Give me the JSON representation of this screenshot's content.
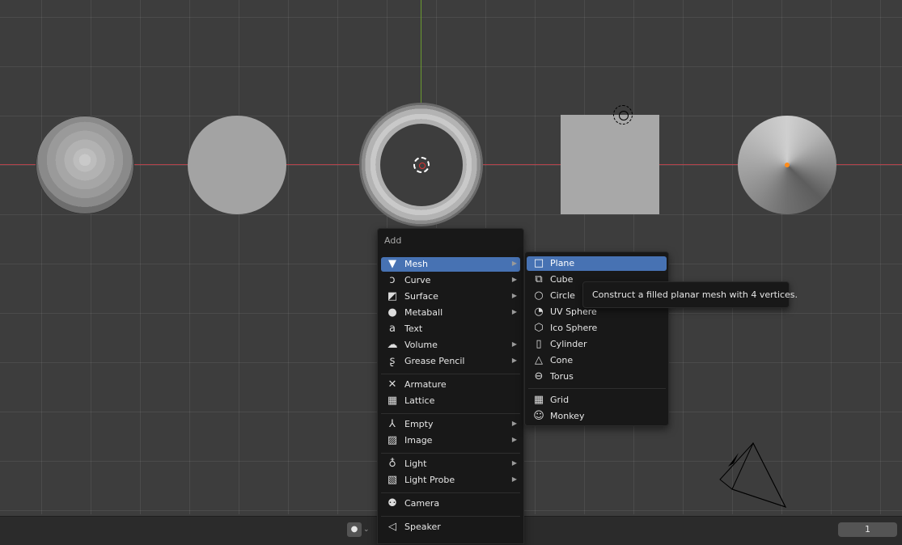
{
  "add_menu": {
    "title": "Add",
    "items": [
      {
        "label": "Mesh",
        "icon": "mesh-icon",
        "has_submenu": true,
        "active": true
      },
      {
        "label": "Curve",
        "icon": "curve-icon",
        "has_submenu": true
      },
      {
        "label": "Surface",
        "icon": "surface-icon",
        "has_submenu": true
      },
      {
        "label": "Metaball",
        "icon": "metaball-icon",
        "has_submenu": true
      },
      {
        "label": "Text",
        "icon": "text-icon",
        "has_submenu": false
      },
      {
        "label": "Volume",
        "icon": "volume-icon",
        "has_submenu": true
      },
      {
        "label": "Grease Pencil",
        "icon": "grease-pencil-icon",
        "has_submenu": true
      },
      {
        "label": "Armature",
        "icon": "armature-icon",
        "has_submenu": false
      },
      {
        "label": "Lattice",
        "icon": "lattice-icon",
        "has_submenu": false
      },
      {
        "label": "Empty",
        "icon": "empty-icon",
        "has_submenu": true
      },
      {
        "label": "Image",
        "icon": "image-icon",
        "has_submenu": true
      },
      {
        "label": "Light",
        "icon": "light-icon",
        "has_submenu": true
      },
      {
        "label": "Light Probe",
        "icon": "light-probe-icon",
        "has_submenu": true
      },
      {
        "label": "Camera",
        "icon": "camera-icon",
        "has_submenu": false
      },
      {
        "label": "Speaker",
        "icon": "speaker-icon",
        "has_submenu": false
      }
    ]
  },
  "mesh_menu": {
    "items": [
      {
        "label": "Plane",
        "icon": "plane-icon",
        "active": true
      },
      {
        "label": "Cube",
        "icon": "cube-icon"
      },
      {
        "label": "Circle",
        "icon": "circle-icon"
      },
      {
        "label": "UV Sphere",
        "icon": "uv-sphere-icon"
      },
      {
        "label": "Ico Sphere",
        "icon": "ico-sphere-icon"
      },
      {
        "label": "Cylinder",
        "icon": "cylinder-icon"
      },
      {
        "label": "Cone",
        "icon": "cone-icon"
      },
      {
        "label": "Torus",
        "icon": "torus-icon"
      },
      {
        "label": "Grid",
        "icon": "grid-icon"
      },
      {
        "label": "Monkey",
        "icon": "monkey-icon"
      }
    ]
  },
  "tooltip": {
    "text": "Construct a filled planar mesh with 4 vertices."
  },
  "timeline": {
    "current_frame": "1"
  },
  "colors": {
    "accent": "#4772b3",
    "menu_bg": "#181818",
    "viewport_bg": "#3d3d3d",
    "x_axis": "#b3424a",
    "y_axis": "#6b9a2f"
  }
}
